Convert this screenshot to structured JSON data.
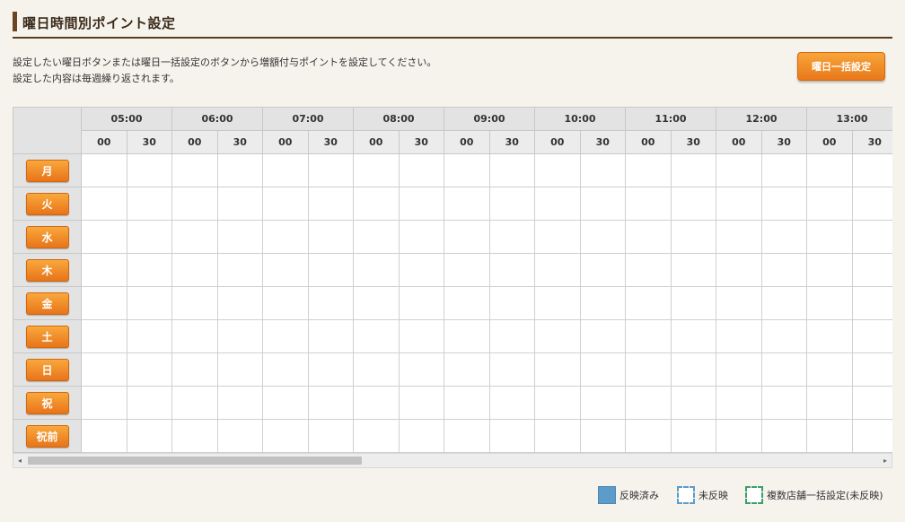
{
  "page": {
    "title": "曜日時間別ポイント設定",
    "description": [
      "設定したい曜日ボタンまたは曜日一括設定のボタンから増額付与ポイントを設定してください。",
      "設定した内容は毎週繰り返されます。"
    ],
    "bulk_button": "曜日一括設定"
  },
  "grid": {
    "hours": [
      "05:00",
      "06:00",
      "07:00",
      "08:00",
      "09:00",
      "10:00",
      "11:00",
      "12:00",
      "13:00"
    ],
    "minutes": [
      "00",
      "30"
    ],
    "days": [
      "月",
      "火",
      "水",
      "木",
      "金",
      "土",
      "日",
      "祝",
      "祝前"
    ]
  },
  "legend": {
    "applied": "反映済み",
    "pending": "未反映",
    "multi_store_pending": "複数店舗一括設定(未反映)"
  },
  "scrollbar": {
    "left_arrow": "◂",
    "right_arrow": "▸"
  },
  "colors": {
    "accent_orange": "#e9781a",
    "applied_blue": "#5d9bc9",
    "multi_green": "#3aa06a",
    "title_brown": "#6b4423"
  }
}
